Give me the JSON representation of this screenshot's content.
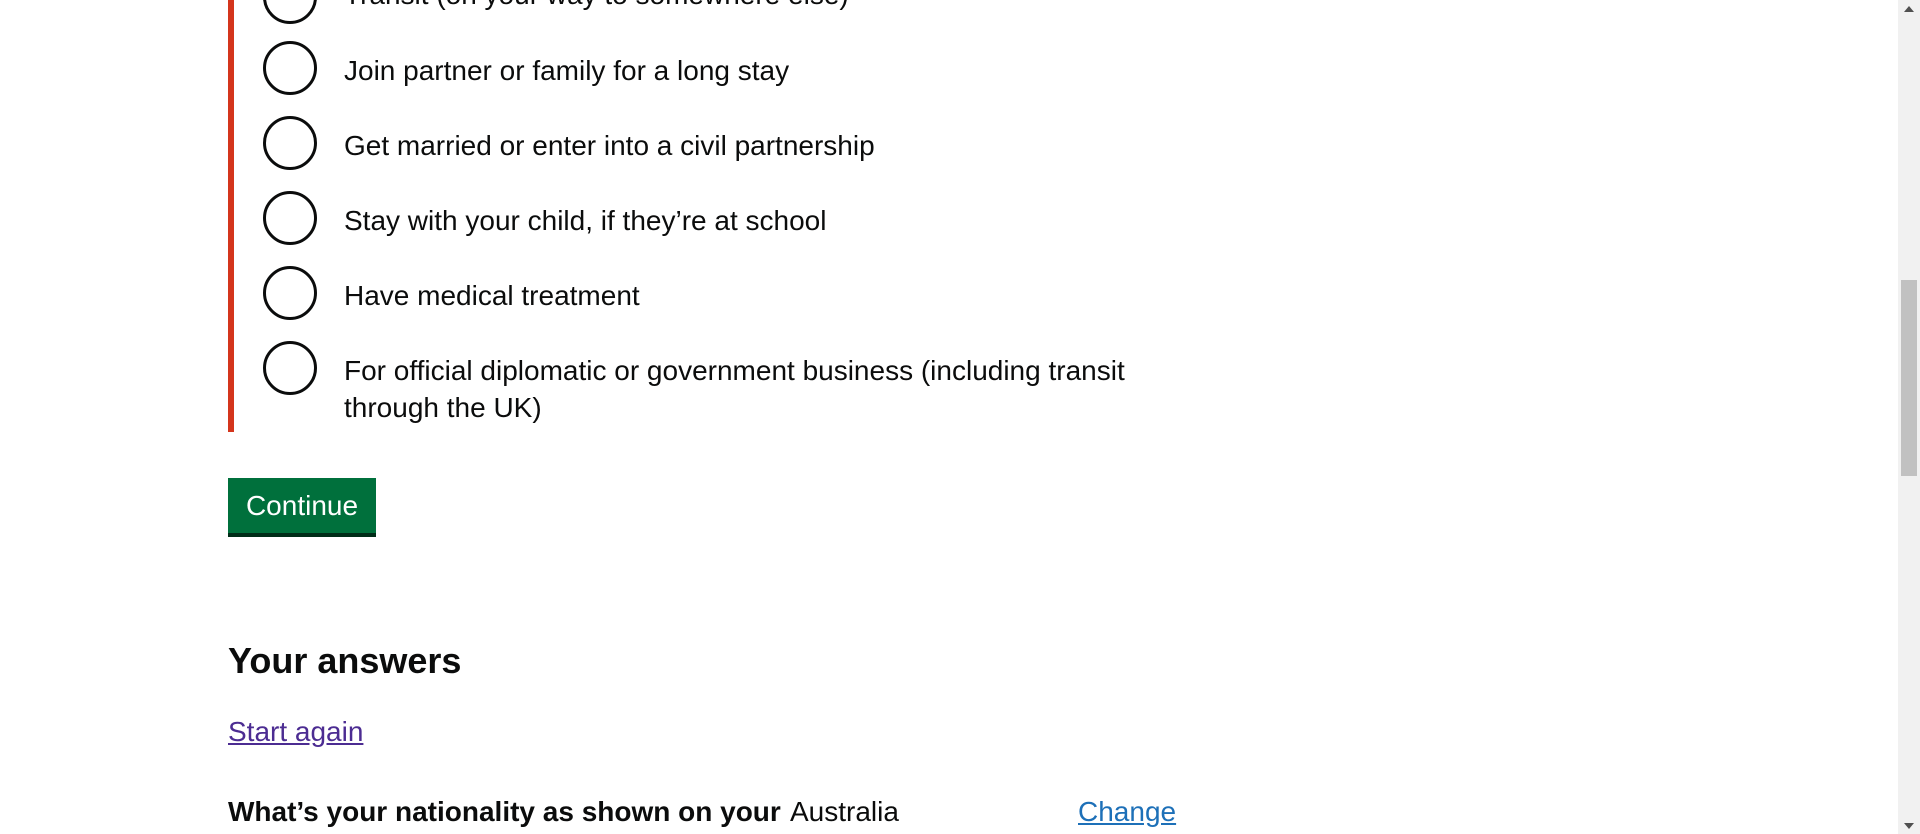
{
  "radio_options": [
    "Transit (on your way to somewhere else)",
    "Join partner or family for a long stay",
    "Get married or enter into a civil partnership",
    "Stay with your child, if they’re at school",
    "Have medical treatment",
    "For official diplomatic or government business (including transit through the UK)"
  ],
  "form": {
    "continue_label": "Continue"
  },
  "answers": {
    "heading": "Your answers",
    "start_again": "Start again",
    "rows": [
      {
        "question": "What’s your nationality as shown on your",
        "answer": "Australia",
        "action": "Change"
      }
    ]
  },
  "colors": {
    "error_border": "#d4351c",
    "button_green": "#00703c",
    "link_blue": "#1d70b8",
    "visited_link": "#4c2c92"
  }
}
